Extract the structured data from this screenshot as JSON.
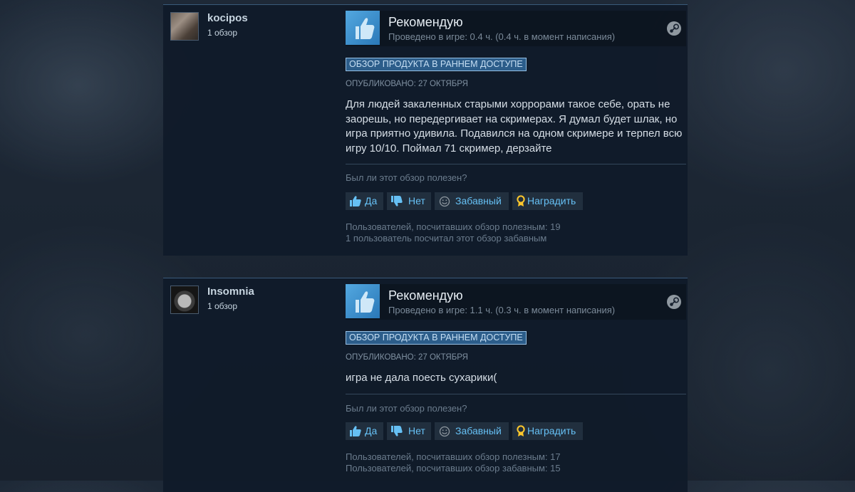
{
  "reviews": [
    {
      "author": "kocipos",
      "reviews_count": "1 обзор",
      "verdict": "Рекомендую",
      "playtime": "Проведено в игре: 0.4 ч. (0.4 ч. в момент написания)",
      "badge": "ОБЗОР ПРОДУКТА В РАННЕМ ДОСТУПЕ",
      "posted": "ОПУБЛИКОВАНО: 27 ОКТЯБРЯ",
      "text": "Для людей закаленных старыми хоррорами такое себе, орать не заорешь, но передергивает на скримерах. Я думал будет шлак, но игра приятно удивила. Подавился на одном скримере и терпел всю игру 10/10. Поймал 71 скример, дерзайте",
      "helpful_question": "Был ли этот обзор полезен?",
      "buttons": {
        "yes": "Да",
        "no": "Нет",
        "funny": "Забавный",
        "award": "Наградить"
      },
      "stat_helpful": "Пользователей, посчитавших обзор полезным: 19",
      "stat_funny": "1 пользователь посчитал этот обзор забавным"
    },
    {
      "author": "Insomnia",
      "reviews_count": "1 обзор",
      "verdict": "Рекомендую",
      "playtime": "Проведено в игре: 1.1 ч. (0.3 ч. в момент написания)",
      "badge": "ОБЗОР ПРОДУКТА В РАННЕМ ДОСТУПЕ",
      "posted": "ОПУБЛИКОВАНО: 27 ОКТЯБРЯ",
      "text": "игра не дала поесть сухарики(",
      "helpful_question": "Был ли этот обзор полезен?",
      "buttons": {
        "yes": "Да",
        "no": "Нет",
        "funny": "Забавный",
        "award": "Наградить"
      },
      "stat_helpful": "Пользователей, посчитавших обзор полезным: 17",
      "stat_funny": "Пользователей, посчитавших обзор забавным: 15"
    }
  ],
  "icons": {
    "thumb": "thumbs-up-icon",
    "steam": "steam-icon",
    "yes": "thumbs-up-icon",
    "no": "thumbs-down-icon",
    "funny": "smiley-icon",
    "award": "award-ribbon-icon"
  },
  "colors": {
    "link_blue": "#66c0f4",
    "badge_bg": "#2c5d8a",
    "award_gold": "#ffc82c"
  }
}
